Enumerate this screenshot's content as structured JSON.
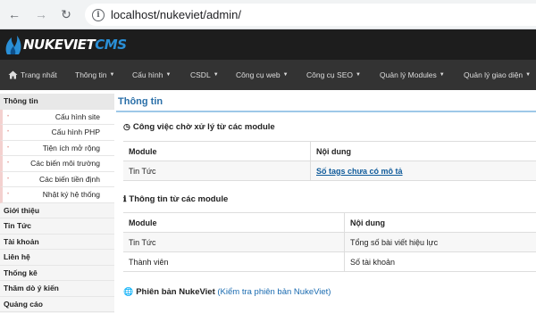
{
  "browser": {
    "url": "localhost/nukeviet/admin/"
  },
  "brand": {
    "logo_main": "NUKEVIET",
    "logo_accent": "CMS"
  },
  "topnav": {
    "items": [
      {
        "label": "Trang nhất",
        "icon": "home-icon"
      },
      {
        "label": "Thông tin"
      },
      {
        "label": "Cấu hình"
      },
      {
        "label": "CSDL"
      },
      {
        "label": "Công cụ web"
      },
      {
        "label": "Công cụ SEO"
      },
      {
        "label": "Quản lý Modules"
      },
      {
        "label": "Quản lý giao diện"
      }
    ]
  },
  "sidebar": {
    "items": [
      {
        "label": "Thông tin"
      },
      {
        "label": "Cấu hình site"
      },
      {
        "label": "Cấu hình PHP"
      },
      {
        "label": "Tiện ích mở rộng"
      },
      {
        "label": "Các biến môi trường"
      },
      {
        "label": "Các biến tiền định"
      },
      {
        "label": "Nhật ký hệ thống"
      },
      {
        "label": "Giới thiệu"
      },
      {
        "label": "Tin Tức"
      },
      {
        "label": "Tài khoản"
      },
      {
        "label": "Liên hệ"
      },
      {
        "label": "Thống kê"
      },
      {
        "label": "Thăm dò ý kiến"
      },
      {
        "label": "Quảng cáo"
      }
    ]
  },
  "main": {
    "title": "Thông tin",
    "pending": {
      "title": "Công việc chờ xử lý từ các module",
      "headers": [
        "Module",
        "Nội dung"
      ],
      "rows": [
        [
          "Tin Tức",
          "Số tags chưa có mô tả"
        ]
      ]
    },
    "info": {
      "title": "Thông tin từ các module",
      "headers": [
        "Module",
        "Nội dung"
      ],
      "rows": [
        [
          "Tin Tức",
          "Tổng số bài viết hiệu lực"
        ],
        [
          "Thành viên",
          "Số tài khoản"
        ]
      ]
    },
    "version": {
      "title": "Phiên bản NukeViet",
      "link": "(Kiểm tra phiên bản NukeViet)"
    }
  },
  "colors": {
    "brand_bar": "#1d1d1d",
    "nav_bar": "#333333",
    "accent": "#2a6fa8",
    "logo_accent": "#2a8fd6"
  }
}
